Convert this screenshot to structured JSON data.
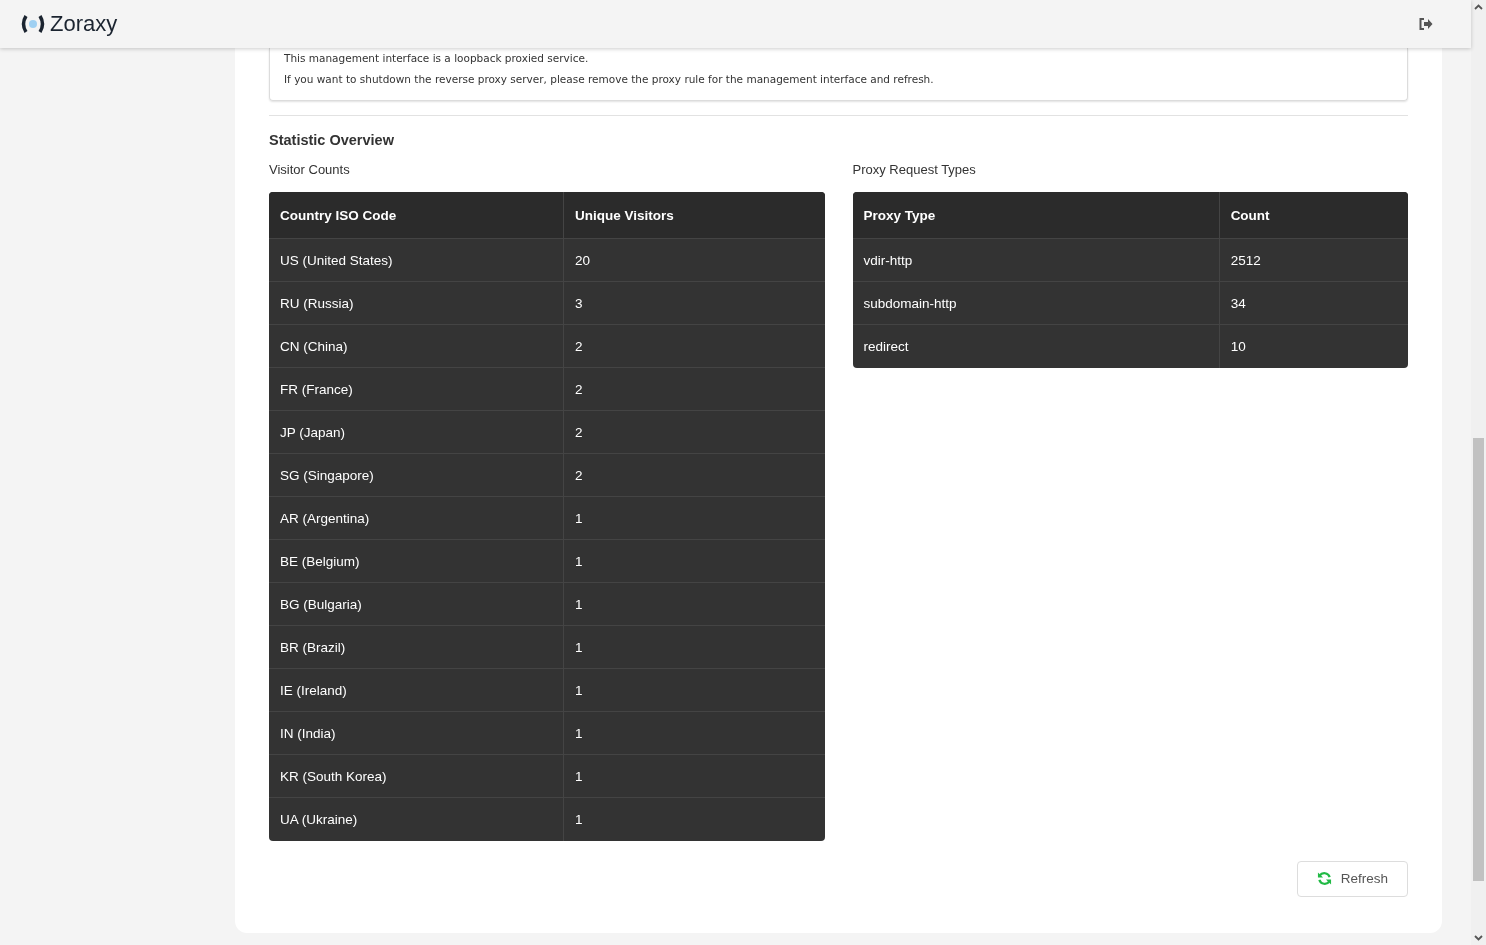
{
  "header": {
    "brand": "Zoraxy"
  },
  "notice": [
    "This management interface is a loopback proxied service.",
    "If you want to shutdown the reverse proxy server, please remove the proxy rule for the management interface and refresh."
  ],
  "statistic_overview": {
    "title": "Statistic Overview",
    "visitor_counts": {
      "title": "Visitor Counts",
      "columns": [
        "Country ISO Code",
        "Unique Visitors"
      ],
      "rows": [
        [
          "US (United States)",
          "20"
        ],
        [
          "RU (Russia)",
          "3"
        ],
        [
          "CN (China)",
          "2"
        ],
        [
          "FR (France)",
          "2"
        ],
        [
          "JP (Japan)",
          "2"
        ],
        [
          "SG (Singapore)",
          "2"
        ],
        [
          "AR (Argentina)",
          "1"
        ],
        [
          "BE (Belgium)",
          "1"
        ],
        [
          "BG (Bulgaria)",
          "1"
        ],
        [
          "BR (Brazil)",
          "1"
        ],
        [
          "IE (Ireland)",
          "1"
        ],
        [
          "IN (India)",
          "1"
        ],
        [
          "KR (South Korea)",
          "1"
        ],
        [
          "UA (Ukraine)",
          "1"
        ]
      ]
    },
    "proxy_request_types": {
      "title": "Proxy Request Types",
      "columns": [
        "Proxy Type",
        "Count"
      ],
      "rows": [
        [
          "vdir-http",
          "2512"
        ],
        [
          "subdomain-http",
          "34"
        ],
        [
          "redirect",
          "10"
        ]
      ]
    }
  },
  "refresh_button": "Refresh"
}
